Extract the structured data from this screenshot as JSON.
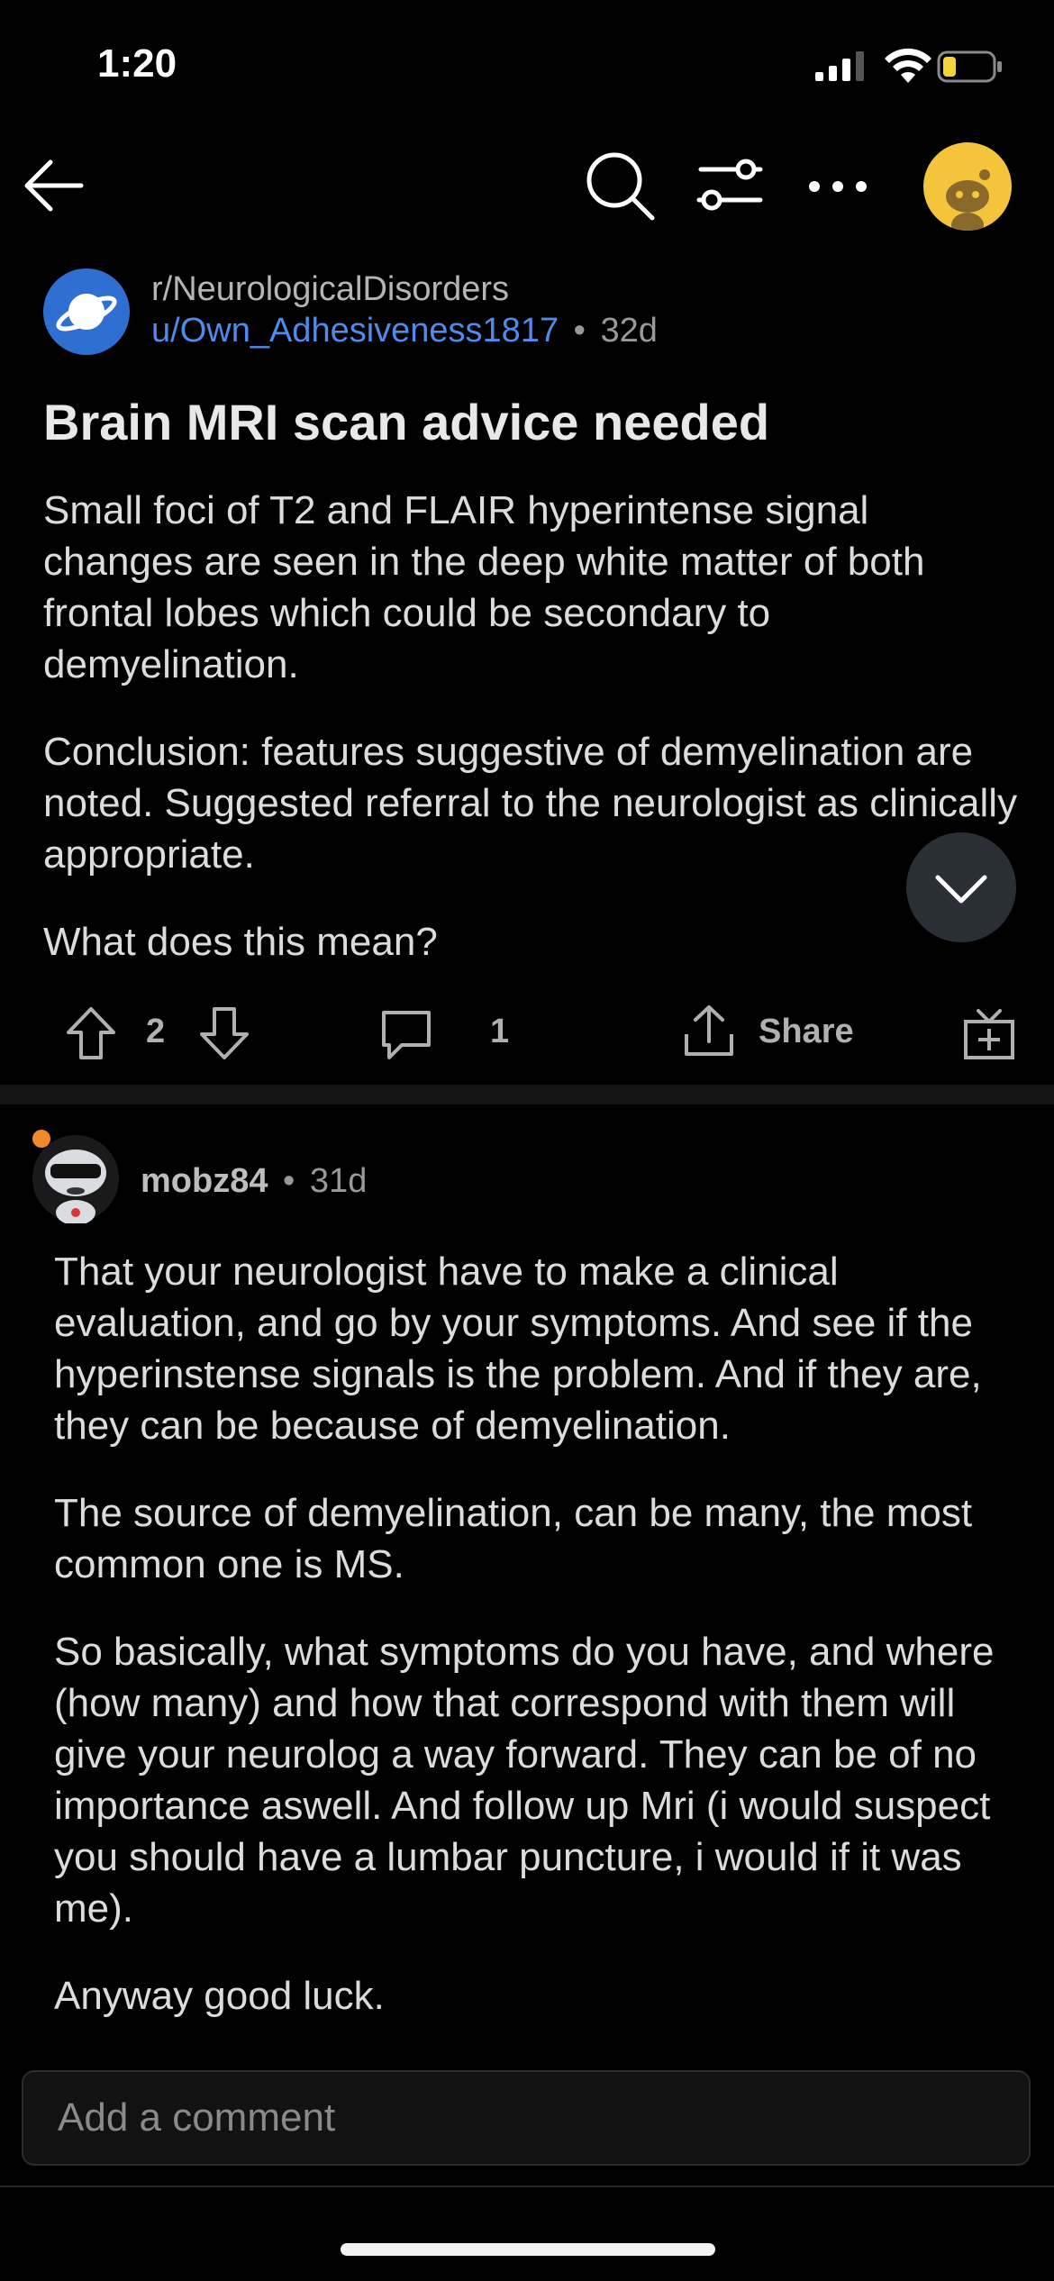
{
  "status_bar": {
    "time": "1:20"
  },
  "post": {
    "subreddit": "r/NeurologicalDisorders",
    "author": "u/Own_Adhesiveness1817",
    "separator": "•",
    "age": "32d",
    "title": "Brain MRI scan advice needed",
    "paragraphs": [
      "Small foci of T2 and FLAIR hyperintense signal changes are seen in the deep white matter of both frontal lobes which could be secondary to demyelination.",
      "Conclusion: features suggestive of demyelination are noted. Suggested referral to the neurologist as clinically appropriate.",
      "What does this mean?"
    ],
    "votes": "2",
    "comments": "1",
    "share_label": "Share"
  },
  "comment": {
    "author": "mobz84",
    "separator": "•",
    "age": "31d",
    "paragraphs": [
      "That your neurologist have to make a clinical evaluation, and go by your symptoms. And see if the hyperinstense signals is the problem. And if they are, they can be because of demyelination.",
      "The source of demyelination, can be many, the most common one is MS.",
      "So basically, what symptoms do you have, and where (how many) and how that correspond with them will give your neurolog a way forward. They can be of no importance aswell. And follow up Mri (i would suspect you should have a lumbar puncture, i would if it was me).",
      "Anyway good luck."
    ]
  },
  "composer": {
    "placeholder": "Add a comment"
  },
  "colors": {
    "accent": "#4f8bea",
    "avatar_yellow": "#f4c43b",
    "subreddit_blue": "#2f6fd1"
  }
}
